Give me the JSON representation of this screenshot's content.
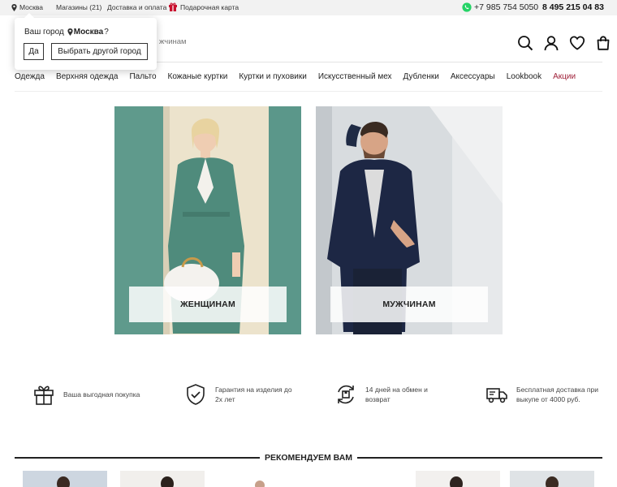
{
  "topbar": {
    "city": "Москва",
    "stores": "Магазины (21)",
    "delivery": "Доставка и оплата",
    "gift_card": "Подарочная карта",
    "phone_mobile": "+7 985 754 5050",
    "phone_main": "8 495 215 04 83"
  },
  "city_popup": {
    "question_prefix": "Ваш город",
    "city": "Москва",
    "question_suffix": "?",
    "yes_label": "Да",
    "other_label": "Выбрать другой город"
  },
  "header": {
    "partial_text": "жчинам",
    "icons": [
      "search-icon",
      "user-icon",
      "heart-icon",
      "bag-icon"
    ]
  },
  "nav": {
    "items": [
      "Одежда",
      "Верхняя одежда",
      "Пальто",
      "Кожаные куртки",
      "Куртки и пуховики",
      "Искусственный мех",
      "Дубленки",
      "Аксессуары",
      "Lookbook",
      "Акции"
    ],
    "sale_color": "#a0233b"
  },
  "banners": {
    "women": "ЖЕНЩИНАМ",
    "men": "МУЖЧИНАМ"
  },
  "features": [
    {
      "icon": "gift-icon",
      "text": "Ваша выгодная покупка"
    },
    {
      "icon": "shield-check-icon",
      "text_line1": "Гарантия на изделия до",
      "text_line2": "2х лет"
    },
    {
      "icon": "exchange-icon",
      "text_line1": "14 дней на обмен и",
      "text_line2": "возврат"
    },
    {
      "icon": "truck-icon",
      "text_line1": "Бесплатная доставка при",
      "text_line2": "выкупе от 4000 руб."
    }
  ],
  "recommend": {
    "title": "РЕКОМЕНДУЕМ ВАМ"
  }
}
